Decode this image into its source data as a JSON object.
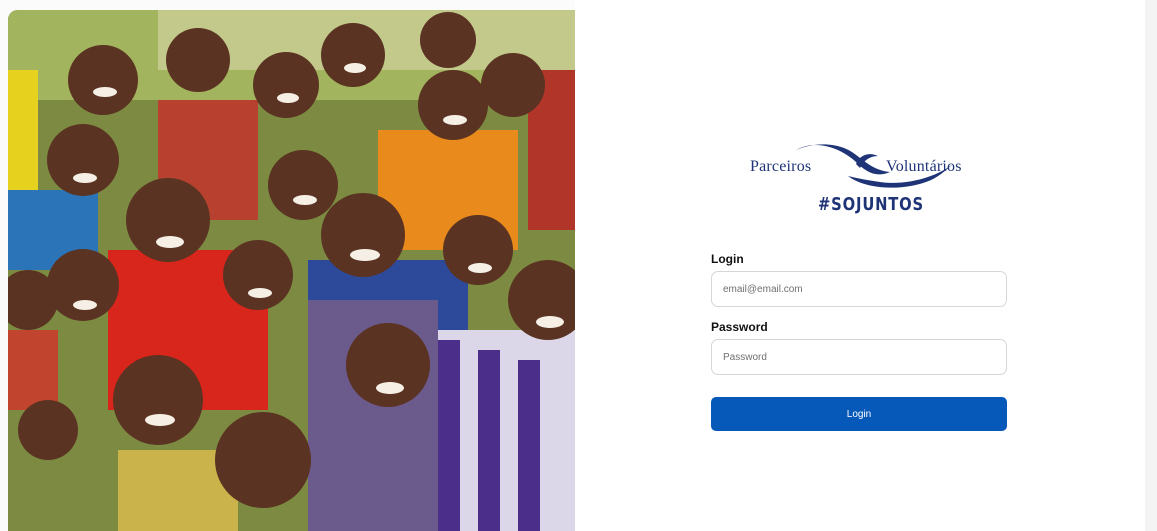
{
  "hero": {
    "image_description_icon": "photo-of-smiling-children"
  },
  "logo": {
    "left_text": "Parceiros",
    "right_text": "Voluntários",
    "tagline": "#SOJUNTOS",
    "color": "#1f3477"
  },
  "form": {
    "login_label": "Login",
    "login_placeholder": "email@email.com",
    "password_label": "Password",
    "password_placeholder": "Password",
    "submit_label": "Login",
    "accent_color": "#0659b8"
  }
}
